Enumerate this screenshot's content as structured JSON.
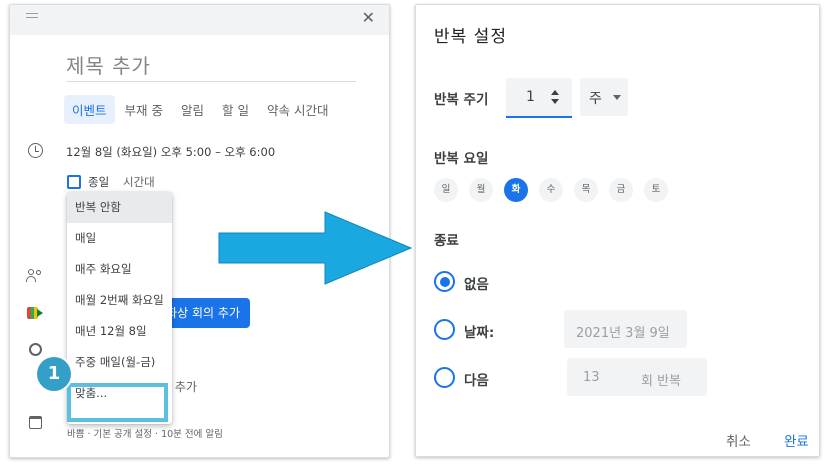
{
  "event_editor": {
    "title_placeholder": "제목 추가",
    "tabs": [
      {
        "label": "이벤트",
        "active": true
      },
      {
        "label": "부재 중",
        "active": false
      },
      {
        "label": "알림",
        "active": false
      },
      {
        "label": "할 일",
        "active": false
      },
      {
        "label": "약속 시간대",
        "active": false
      }
    ],
    "datetime": "12월 8일 (화요일)   오후 5:00  –  오후 6:00",
    "all_day_label": "종일",
    "timezone_label": "시간대",
    "meet_button_label": "화상 회의 추가",
    "description_label": "일 추가",
    "footer_info": "바쁨 · 기본 공개 설정 · 10분 전에 알림",
    "close_glyph": "✕",
    "recurrence_options": [
      {
        "label": "반복 안함",
        "selected": true
      },
      {
        "label": "매일",
        "selected": false
      },
      {
        "label": "매주 화요일",
        "selected": false
      },
      {
        "label": "매월 2번째 화요일",
        "selected": false
      },
      {
        "label": "매년 12월 8일",
        "selected": false
      },
      {
        "label": "주중 매일(월-금)",
        "selected": false
      },
      {
        "label": "맞춤...",
        "selected": false
      }
    ],
    "step_badge": "1",
    "accent_color": "#1a73e8",
    "highlight_color": "#5bc0de"
  },
  "recurrence_dialog": {
    "title": "반복 설정",
    "interval_label": "반복 주기",
    "interval_value": "1",
    "unit_value": "주",
    "weekday_label": "반복 요일",
    "weekdays": [
      {
        "label": "일",
        "on": false
      },
      {
        "label": "월",
        "on": false
      },
      {
        "label": "화",
        "on": true
      },
      {
        "label": "수",
        "on": false
      },
      {
        "label": "목",
        "on": false
      },
      {
        "label": "금",
        "on": false
      },
      {
        "label": "토",
        "on": false
      }
    ],
    "end_label": "종료",
    "end_options": {
      "never": {
        "label": "없음",
        "checked": true
      },
      "on_date": {
        "label": "날짜:",
        "checked": false,
        "value": "2021년 3월 9일"
      },
      "after": {
        "label": "다음",
        "checked": false,
        "count": "13",
        "suffix": "회 반복"
      }
    },
    "cancel_label": "취소",
    "done_label": "완료"
  },
  "arrow_color": "#19a8e0"
}
